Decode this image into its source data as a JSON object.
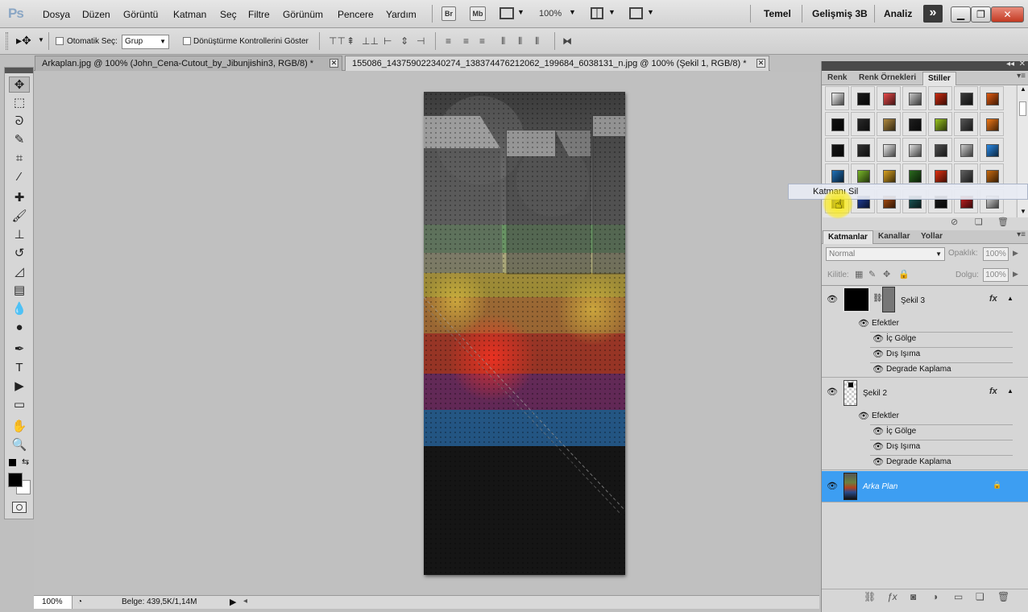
{
  "app": {
    "logo": "Ps",
    "menus": [
      "Dosya",
      "Düzen",
      "Görüntü",
      "Katman",
      "Seç",
      "Filtre",
      "Görünüm",
      "Pencere",
      "Yardım"
    ],
    "bridge_label": "Br",
    "minibridge_label": "Mb",
    "zoom_label": "100%",
    "workspaces": [
      "Temel",
      "Gelişmiş 3B",
      "Analiz"
    ],
    "overflow_label": "»"
  },
  "options": {
    "auto_select_label": "Otomatik Seç:",
    "auto_select_value": "Grup",
    "transform_controls_label": "Dönüştürme Kontrollerini Göster"
  },
  "documents": {
    "tabs": [
      {
        "label": "Arkaplan.jpg @ 100% (John_Cena-Cutout_by_Jibunjishin3, RGB/8) *",
        "active": false
      },
      {
        "label": "155086_143759022340274_138374476212062_199684_6038131_n.jpg @ 100% (Şekil 1, RGB/8) *",
        "active": true
      }
    ]
  },
  "status": {
    "zoom": "100%",
    "doc_size": "Belge: 439,5K/1,14M"
  },
  "styles_panel": {
    "tabs": [
      "Renk",
      "Renk Örnekleri",
      "Stiller"
    ],
    "active_tab": "Stiller",
    "tooltip": "Katmanı Sil",
    "swatch_colors": [
      "#f4f4f4",
      "#1a1a1a",
      "#e84a4a",
      "#c8c8c8",
      "#cc2a10",
      "#3a3a3a",
      "#e05a10",
      "#111111",
      "#2a2a2a",
      "#b08a40",
      "#1e1e1e",
      "#99c420",
      "#555555",
      "#f07818",
      "#151515",
      "#333333",
      "#ececec",
      "#e0e0e0",
      "#505050",
      "#cccccc",
      "#2a8ae6",
      "#1e70b8",
      "#7ab82a",
      "#d8a020",
      "#2a6a1e",
      "#e03010",
      "#606060",
      "#c86a10",
      "#2020c8",
      "#2040a0",
      "#b05010",
      "#1a5a5a",
      "#1a1a1a",
      "#c82020",
      "#d8d8d8"
    ]
  },
  "layers_panel": {
    "tabs": [
      "Katmanlar",
      "Kanallar",
      "Yollar"
    ],
    "active_tab": "Katmanlar",
    "blend_mode": "Normal",
    "opacity_label": "Opaklık:",
    "opacity_value": "100%",
    "lock_label": "Kilitle:",
    "fill_label": "Dolgu:",
    "fill_value": "100%",
    "layers": [
      {
        "name": "Şekil 3",
        "fx": "fx",
        "effects_label": "Efektler",
        "effects": [
          "İç Gölge",
          "Dış Işıma",
          "Degrade Kaplama"
        ]
      },
      {
        "name": "Şekil 2",
        "fx": "fx",
        "effects_label": "Efektler",
        "effects": [
          "İç Gölge",
          "Dış Işıma",
          "Degrade Kaplama"
        ]
      },
      {
        "name": "Arka Plan",
        "selected": true
      }
    ]
  }
}
